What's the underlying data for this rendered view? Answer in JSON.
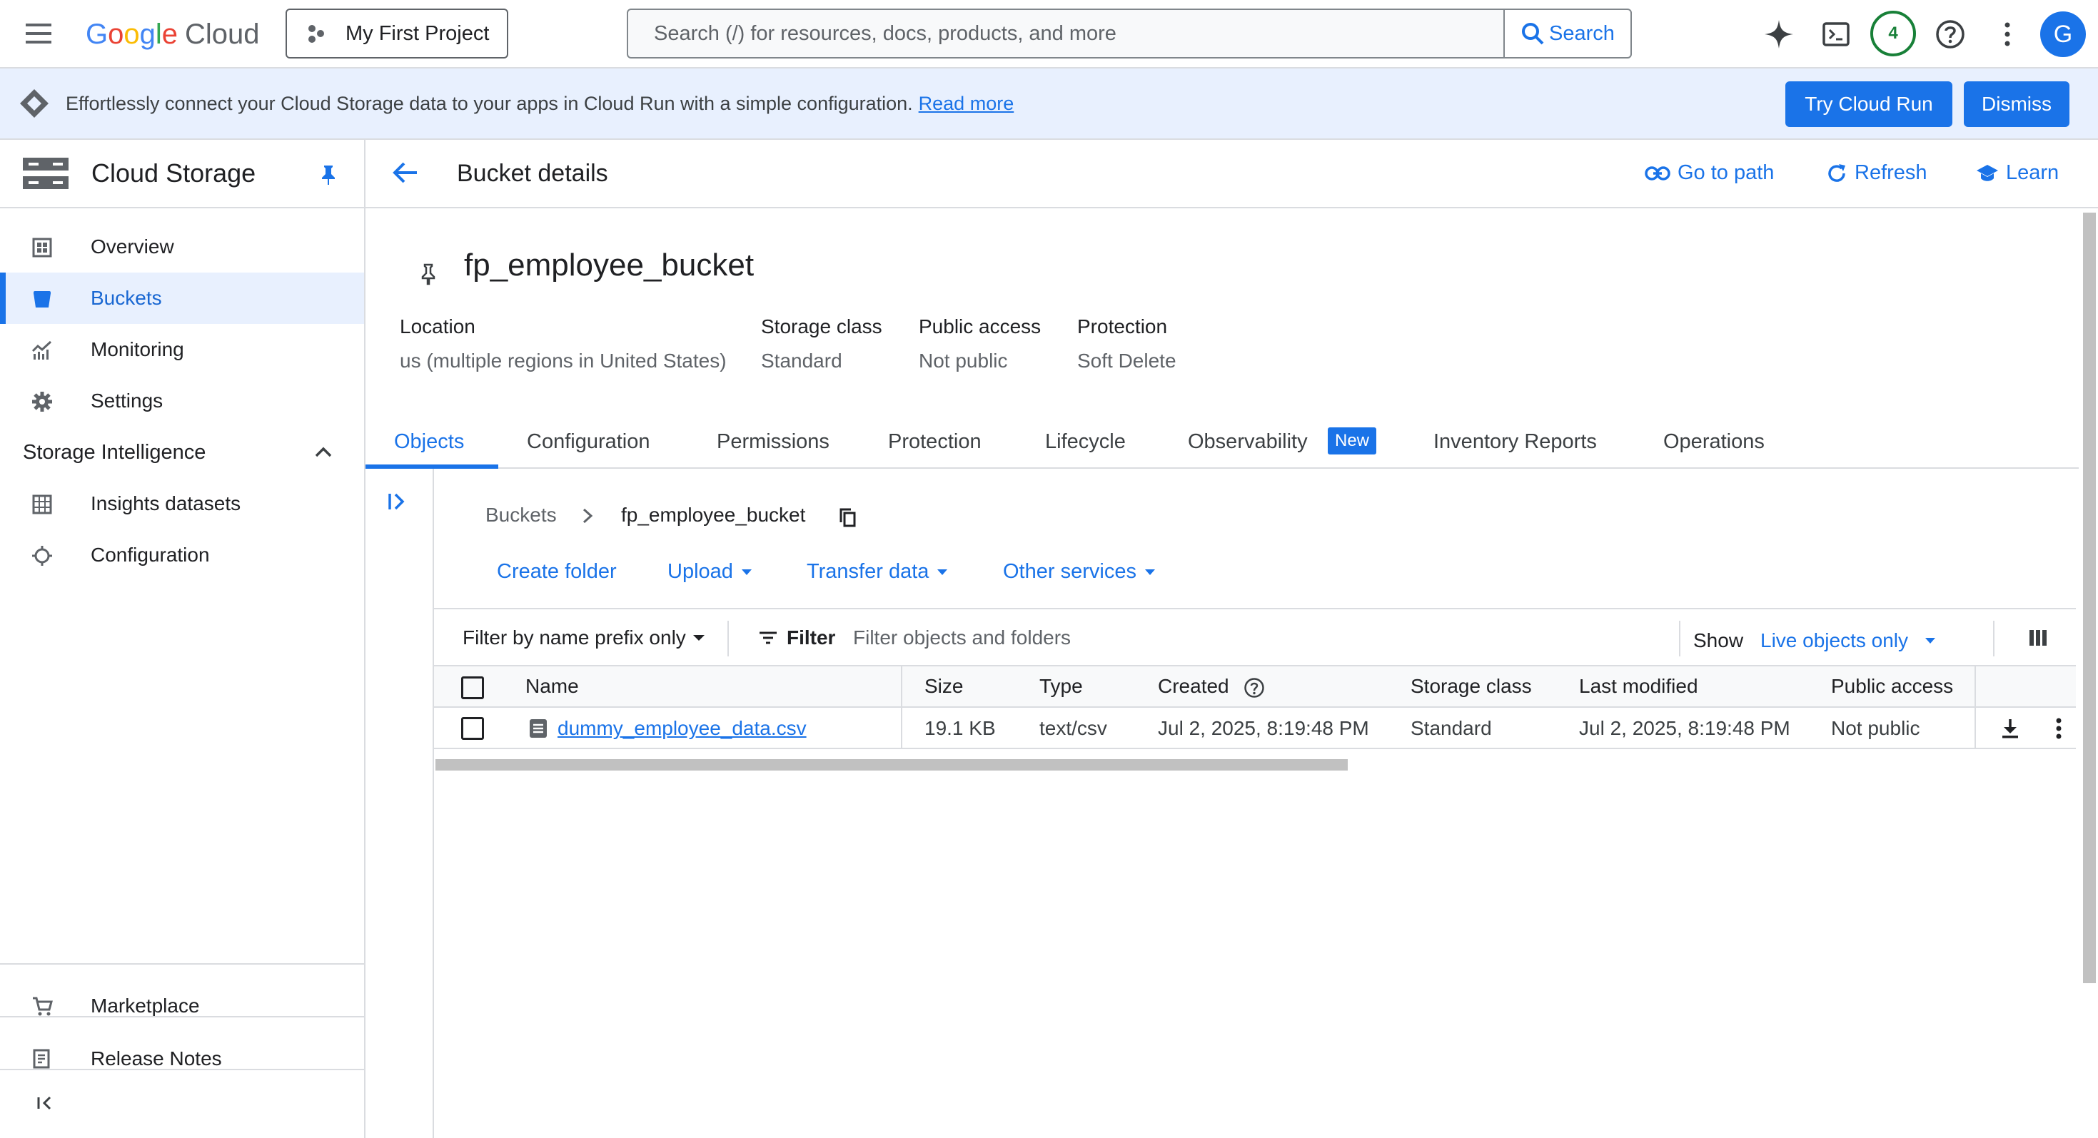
{
  "topbar": {
    "logo_google": [
      "G",
      "o",
      "o",
      "g",
      "l",
      "e"
    ],
    "logo_cloud": "Cloud",
    "project": "My First Project",
    "search_placeholder": "Search (/) for resources, docs, products, and more",
    "search_button": "Search",
    "notifications_count": "4",
    "avatar_initial": "G"
  },
  "banner": {
    "text": "Effortlessly connect your Cloud Storage data to your apps in Cloud Run with a simple configuration.",
    "link": "Read more",
    "try_button": "Try Cloud Run",
    "dismiss_button": "Dismiss"
  },
  "sidebar": {
    "title": "Cloud Storage",
    "items": [
      {
        "label": "Overview",
        "icon": "overview-icon"
      },
      {
        "label": "Buckets",
        "icon": "bucket-icon",
        "active": true
      },
      {
        "label": "Monitoring",
        "icon": "monitoring-icon"
      },
      {
        "label": "Settings",
        "icon": "gear-icon"
      }
    ],
    "section": "Storage Intelligence",
    "section_items": [
      {
        "label": "Insights datasets",
        "icon": "dataset-icon"
      },
      {
        "label": "Configuration",
        "icon": "config-icon"
      }
    ],
    "bottom_items": [
      {
        "label": "Marketplace",
        "icon": "cart-icon"
      },
      {
        "label": "Release Notes",
        "icon": "notes-icon"
      }
    ]
  },
  "header": {
    "title": "Bucket details",
    "go_to_path": "Go to path",
    "refresh": "Refresh",
    "learn": "Learn"
  },
  "bucket": {
    "name": "fp_employee_bucket",
    "location_label": "Location",
    "location_value": "us (multiple regions in United States)",
    "storage_class_label": "Storage class",
    "storage_class_value": "Standard",
    "public_access_label": "Public access",
    "public_access_value": "Not public",
    "protection_label": "Protection",
    "protection_value": "Soft Delete"
  },
  "tabs": {
    "objects": "Objects",
    "configuration": "Configuration",
    "permissions": "Permissions",
    "protection": "Protection",
    "lifecycle": "Lifecycle",
    "observability": "Observability",
    "new_badge": "New",
    "inventory": "Inventory Reports",
    "operations": "Operations"
  },
  "breadcrumb": {
    "root": "Buckets",
    "current": "fp_employee_bucket"
  },
  "actions": {
    "create_folder": "Create folder",
    "upload": "Upload",
    "transfer": "Transfer data",
    "other": "Other services"
  },
  "filter": {
    "mode": "Filter by name prefix only",
    "label": "Filter",
    "placeholder": "Filter objects and folders",
    "show_label": "Show",
    "show_value": "Live objects only"
  },
  "table": {
    "columns": {
      "name": "Name",
      "size": "Size",
      "type": "Type",
      "created": "Created",
      "storage_class": "Storage class",
      "last_modified": "Last modified",
      "public_access": "Public access"
    },
    "rows": [
      {
        "name": "dummy_employee_data.csv",
        "size": "19.1 KB",
        "type": "text/csv",
        "created": "Jul 2, 2025, 8:19:48 PM",
        "storage_class": "Standard",
        "last_modified": "Jul 2, 2025, 8:19:48 PM",
        "public_access": "Not public"
      }
    ]
  }
}
